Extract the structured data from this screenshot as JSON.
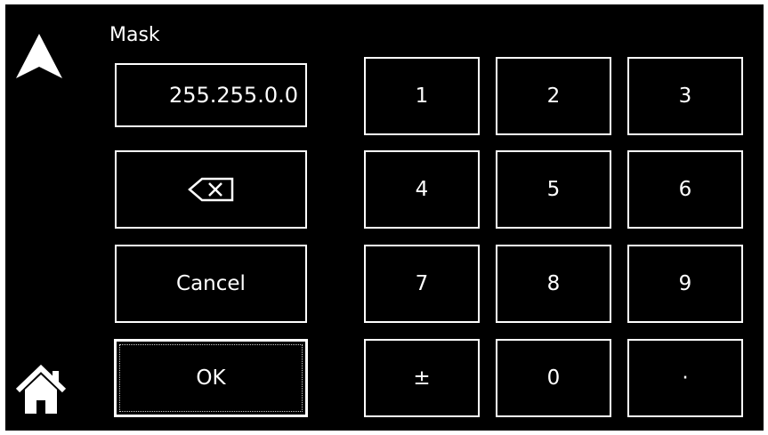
{
  "header": {
    "title": "Mask"
  },
  "nav": {
    "up_icon": "up-arrow-icon",
    "home_icon": "home-icon"
  },
  "field": {
    "value": "255.255.0.0"
  },
  "actions": {
    "backspace_icon": "backspace-icon",
    "cancel_label": "Cancel",
    "ok_label": "OK"
  },
  "keypad": {
    "keys": [
      "1",
      "2",
      "3",
      "4",
      "5",
      "6",
      "7",
      "8",
      "9",
      "±",
      "0",
      "·"
    ]
  },
  "colors": {
    "background": "#000000",
    "foreground": "#ffffff"
  }
}
